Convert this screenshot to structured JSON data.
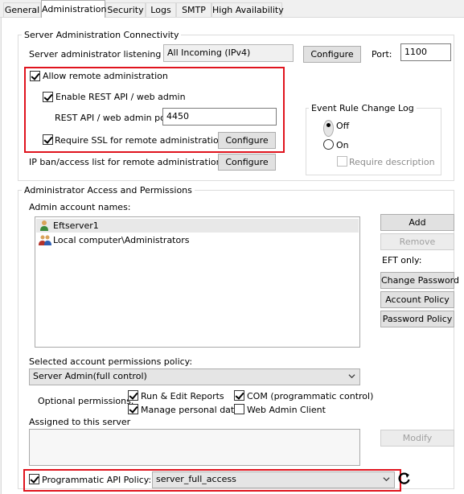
{
  "tabs": [
    {
      "label": "General"
    },
    {
      "label": "Administration"
    },
    {
      "label": "Security"
    },
    {
      "label": "Logs"
    },
    {
      "label": "SMTP"
    },
    {
      "label": "High Availability"
    }
  ],
  "connectivity": {
    "group_label": "Server Administration Connectivity",
    "listen_ip_label": "Server administrator listening IP:",
    "listen_ip_value": "All Incoming (IPv4)",
    "configure_label": "Configure",
    "port_label": "Port:",
    "port_value": "1100",
    "allow_remote_label": "Allow remote administration",
    "allow_remote_checked": true,
    "enable_rest_label": "Enable REST API / web admin",
    "enable_rest_checked": true,
    "rest_port_label": "REST API / web admin port:",
    "rest_port_value": "4450",
    "require_ssl_label": "Require SSL for remote administration:",
    "require_ssl_checked": true,
    "ssl_configure_label": "Configure",
    "ipban_label": "IP ban/access list for remote administration:",
    "ipban_configure_label": "Configure"
  },
  "event_log": {
    "group_label": "Event Rule Change Log",
    "off_label": "Off",
    "on_label": "On",
    "selected": "Off",
    "require_desc_label": "Require description"
  },
  "access": {
    "group_label": "Administrator Access and Permissions",
    "accounts_label": "Admin account names:",
    "accounts": [
      {
        "name": "Eftserver1",
        "icon": "user-icon"
      },
      {
        "name": "Local computer\\Administrators",
        "icon": "group-icon"
      }
    ],
    "add_label": "Add",
    "remove_label": "Remove",
    "eft_only_label": "EFT only:",
    "change_password_label": "Change Password",
    "account_policy_label": "Account Policy",
    "password_policy_label": "Password Policy",
    "policy_label": "Selected account permissions policy:",
    "policy_value": "Server Admin(full control)",
    "optional_label": "Optional permissions:",
    "run_reports_label": "Run & Edit Reports",
    "manage_data_label": "Manage personal data",
    "com_label": "COM (programmatic control)",
    "web_admin_label": "Web Admin Client",
    "assigned_label": "Assigned to this server",
    "modify_label": "Modify",
    "api_policy_label": "Programmatic API Policy:",
    "api_policy_value": "server_full_access"
  },
  "colors": {
    "highlight": "#e0141e"
  }
}
